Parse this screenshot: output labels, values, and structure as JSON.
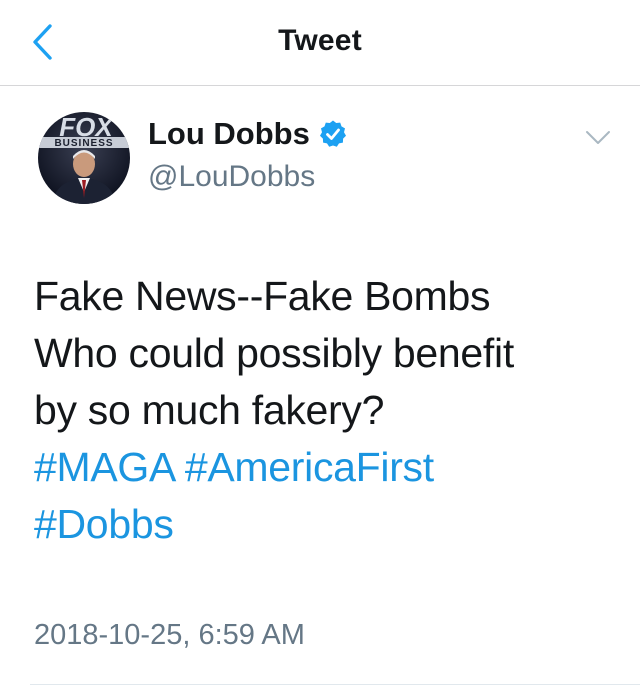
{
  "navbar": {
    "title": "Tweet",
    "back_icon": "chevron-left-icon",
    "accent_color": "#1da1f2"
  },
  "author": {
    "name": "Lou Dobbs",
    "handle": "@LouDobbs",
    "verified": true,
    "verified_badge_color": "#1da1f2",
    "avatar_logo": "FOX BUSINESS"
  },
  "tweet": {
    "lines": [
      "Fake News--Fake Bombs",
      "Who could possibly benefit",
      "by so much fakery?"
    ],
    "hashtags": [
      "#MAGA",
      "#AmericaFirst",
      "#Dobbs"
    ],
    "hashtag_color": "#1b95e0",
    "timestamp": "2018-10-25, 6:59 AM"
  },
  "menu": {
    "icon": "chevron-down-icon"
  }
}
